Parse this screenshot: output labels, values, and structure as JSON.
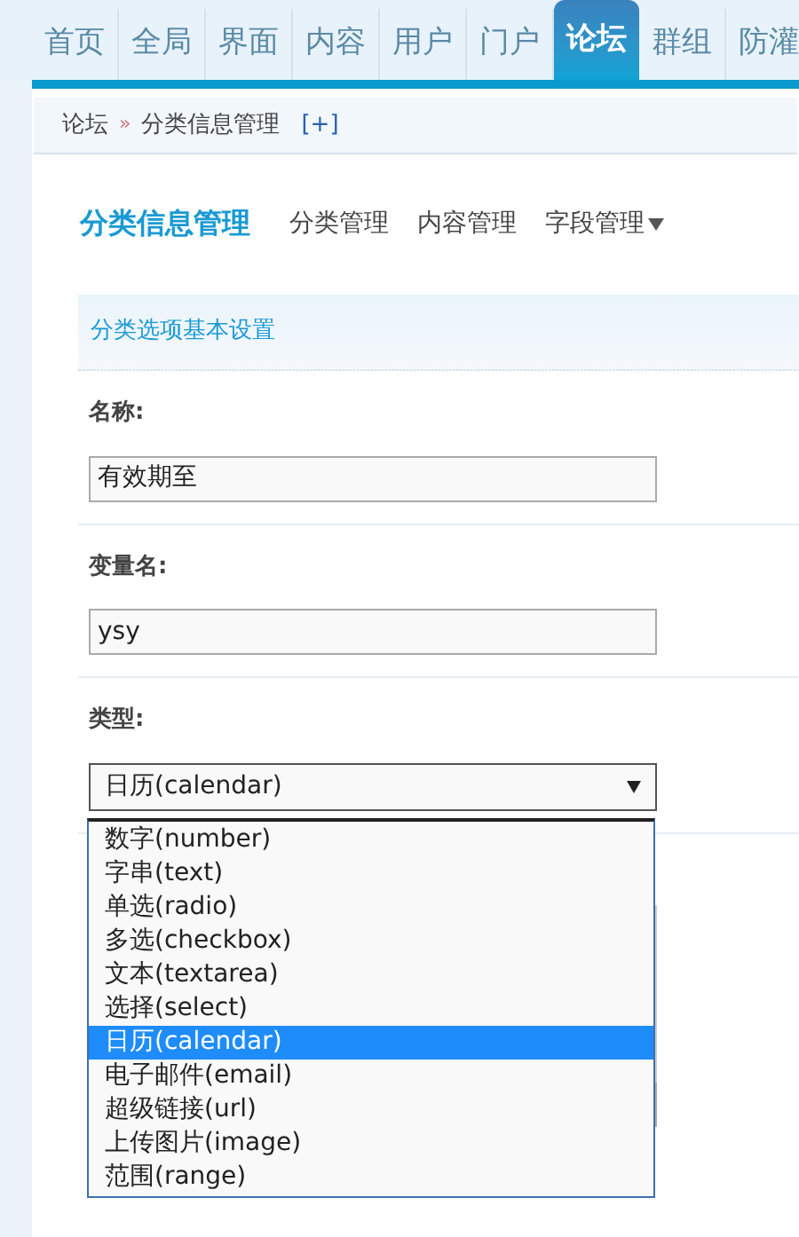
{
  "nav_tabs": [
    {
      "label": "首页",
      "selected": false
    },
    {
      "label": "全局",
      "selected": false
    },
    {
      "label": "界面",
      "selected": false
    },
    {
      "label": "内容",
      "selected": false
    },
    {
      "label": "用户",
      "selected": false
    },
    {
      "label": "门户",
      "selected": false
    },
    {
      "label": "论坛",
      "selected": true
    },
    {
      "label": "群组",
      "selected": false
    },
    {
      "label": "防灌",
      "selected": false
    }
  ],
  "breadcrumb": {
    "items": [
      "论坛",
      "分类信息管理"
    ],
    "separator": "»",
    "add": "[+]"
  },
  "header": {
    "title": "分类信息管理",
    "links": [
      {
        "label": "分类管理",
        "has_menu": false
      },
      {
        "label": "内容管理",
        "has_menu": false
      },
      {
        "label": "字段管理",
        "has_menu": true
      }
    ]
  },
  "section": {
    "title": "分类选项基本设置"
  },
  "fields": [
    {
      "label": "名称:",
      "kind": "text",
      "value": "有效期至"
    },
    {
      "label": "变量名:",
      "kind": "text",
      "value": "ysy"
    },
    {
      "label": "类型:",
      "kind": "select",
      "value": "日历(calendar)",
      "expanded": true
    }
  ],
  "type_options": [
    {
      "label": "数字(number)",
      "selected": false
    },
    {
      "label": "字串(text)",
      "selected": false
    },
    {
      "label": "单选(radio)",
      "selected": false
    },
    {
      "label": "多选(checkbox)",
      "selected": false
    },
    {
      "label": "文本(textarea)",
      "selected": false
    },
    {
      "label": "选择(select)",
      "selected": false
    },
    {
      "label": "日历(calendar)",
      "selected": true
    },
    {
      "label": "电子邮件(email)",
      "selected": false
    },
    {
      "label": "超级链接(url)",
      "selected": false
    },
    {
      "label": "上传图片(image)",
      "selected": false
    },
    {
      "label": "范围(range)",
      "selected": false
    }
  ]
}
